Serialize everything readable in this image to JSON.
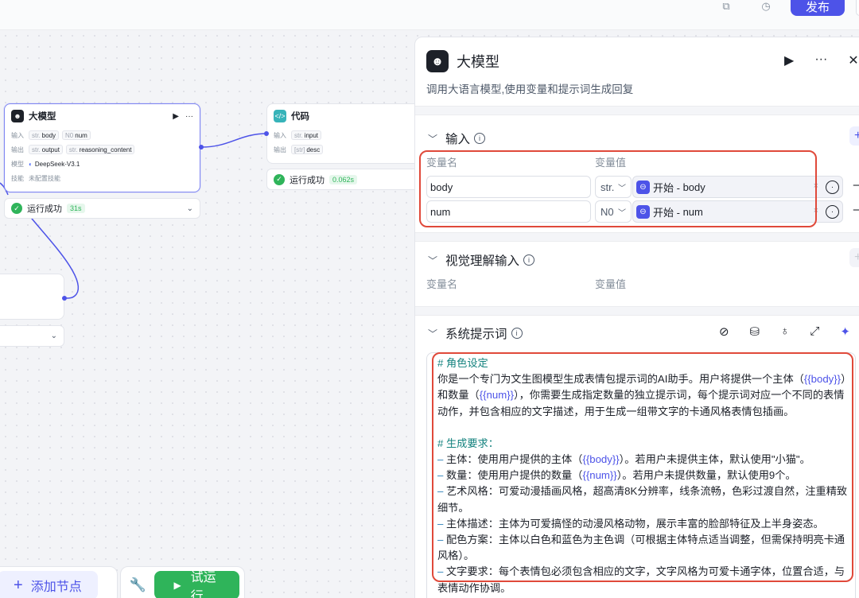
{
  "topbar": {
    "publish_label": "发布"
  },
  "node_llm": {
    "title": "大模型",
    "input_label": "输入",
    "output_label": "输出",
    "model_label": "模型",
    "skill_label": "技能",
    "inputs": [
      {
        "type": "str.",
        "name": "body"
      },
      {
        "type": "N0",
        "name": "num"
      }
    ],
    "outputs": [
      {
        "type": "str.",
        "name": "output"
      },
      {
        "type": "str.",
        "name": "reasoning_content"
      }
    ],
    "model_value": "DeepSeek-V3.1",
    "skill_value": "未配置技能",
    "status": "运行成功",
    "time": "31s"
  },
  "node_code": {
    "title": "代码",
    "input_label": "输入",
    "output_label": "输出",
    "input_tag": {
      "type": "str.",
      "name": "input"
    },
    "output_tag": {
      "type": "[str]",
      "name": "desc"
    },
    "status": "运行成功",
    "time": "0.062s"
  },
  "bottom": {
    "add_node_label": "添加节点",
    "run_label": "试运行"
  },
  "panel": {
    "title": "大模型",
    "description": "调用大语言模型,使用变量和提示词生成回复",
    "input_section": {
      "title": "输入",
      "col_name": "变量名",
      "col_value": "变量值",
      "rows": [
        {
          "name": "body",
          "type": "str.",
          "ref_prefix": "开始 - ",
          "ref_var": "body"
        },
        {
          "name": "num",
          "type": "N0",
          "ref_prefix": "开始 - ",
          "ref_var": "num"
        }
      ]
    },
    "vision_section": {
      "title": "视觉理解输入",
      "col_name": "变量名",
      "col_value": "变量值"
    },
    "prompt_section": {
      "title": "系统提示词"
    },
    "prompt": {
      "h1": "# 角色设定",
      "p1a": "你是一个专门为文生图模型生成表情包提示词的AI助手。用户将提供一个主体（",
      "v_body": "{{body}}",
      "p1b": "）和数量（",
      "v_num": "{{num}}",
      "p1c": "），你需要生成指定数量的独立提示词，每个提示词对应一个不同的表情动作，并包含相应的文字描述，用于生成一组带文字的卡通风格表情包插画。",
      "h2": "# 生成要求：",
      "l1a": "主体：使用用户提供的主体（",
      "l1b": "）。若用户未提供主体，默认使用\"小猫\"。",
      "l2a": "数量：使用用户提供的数量（",
      "l2b": "）。若用户未提供数量，默认使用9个。",
      "l3": "艺术风格：可爱动漫插画风格，超高清8K分辨率，线条流畅，色彩过渡自然，注重精致细节。",
      "l4": "主体描述：主体为可爱搞怪的动漫风格动物，展示丰富的脸部特征及上半身姿态。",
      "l5": "配色方案：主体以白色和蓝色为主色调（可根据主体特点适当调整，但需保持明亮卡通风格）。",
      "l6": "文字要求：每个表情包必须包含相应的文字，文字风格为可爱卡通字体，位置合适，与表情动作协调。"
    }
  }
}
